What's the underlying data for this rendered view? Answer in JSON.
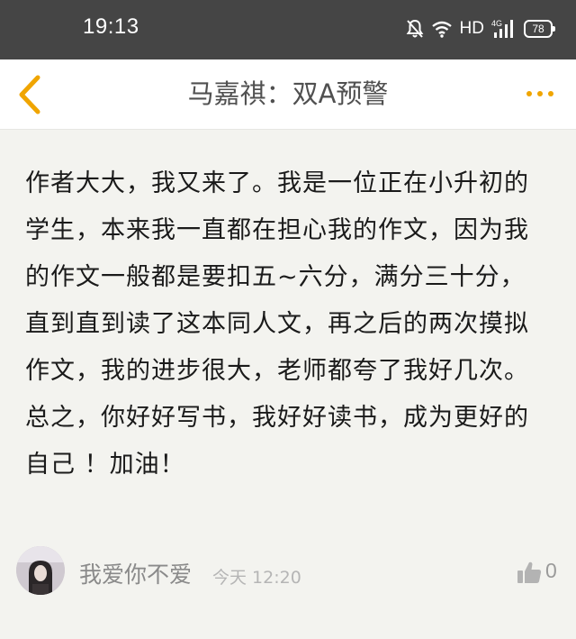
{
  "status_bar": {
    "time": "19:13",
    "network_label": "HD",
    "signal_label": "4G",
    "battery_level": "78"
  },
  "header": {
    "title": "马嘉祺：双A预警"
  },
  "comment": {
    "text": "作者大大，我又来了。我是一位正在小升初的学生，本来我一直都在担心我的作文，因为我的作文一般都是要扣五~六分，满分三十分，直到直到读了这本同人文，再之后的两次摸拟作文，我的进步很大，老师都夸了我好几次。总之，你好好写书，我好好读书，成为更好的自己 ！加油！",
    "author": "我爱你不爱",
    "time": "今天 12:20",
    "likes": "0"
  },
  "colors": {
    "status_bar_bg": "#454545",
    "accent": "#f0a500",
    "background": "#f3f3ef"
  },
  "icons": [
    "mute-icon",
    "wifi-icon",
    "signal-icon",
    "battery-icon",
    "back-chevron-icon",
    "more-dots-icon",
    "thumbs-up-icon",
    "avatar"
  ]
}
